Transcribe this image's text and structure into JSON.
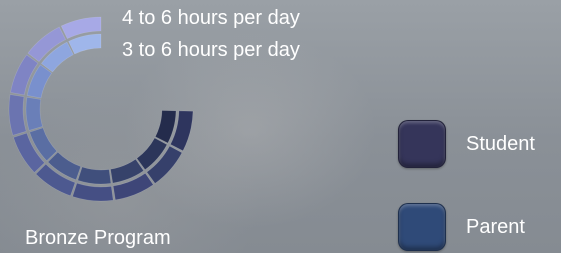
{
  "chart_data": {
    "type": "radial-bar",
    "rings": [
      {
        "label": "4 to 6 hours per day",
        "min_hours": 4,
        "max_hours": 6
      },
      {
        "label": "3 to 6 hours per day",
        "min_hours": 3,
        "max_hours": 6
      }
    ],
    "legend": [
      {
        "name": "Student",
        "color": "#35355a"
      },
      {
        "name": "Parent",
        "color": "#2f4a78"
      }
    ],
    "footer_label": "Bronze Program"
  }
}
